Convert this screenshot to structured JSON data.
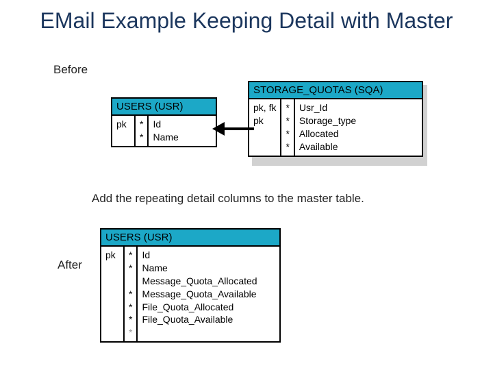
{
  "title": "EMail Example Keeping Detail with Master",
  "labels": {
    "before": "Before",
    "after": "After",
    "middle": "Add the repeating detail columns to the master table."
  },
  "users_before": {
    "header": "USERS (USR)",
    "keys": "pk",
    "stars": "*\n*",
    "cols": "Id\nName"
  },
  "sqa": {
    "header": "STORAGE_QUOTAS (SQA)",
    "keys": "pk, fk\npk",
    "stars": "*\n*\n*\n*",
    "cols": "Usr_Id\nStorage_type\nAllocated\nAvailable"
  },
  "users_after": {
    "header": "USERS (USR)",
    "keys": "pk",
    "stars": "*\n*\n\n*\n*\n*",
    "trailing_star": "*",
    "cols": "Id\nName\nMessage_Quota_Allocated\nMessage_Quota_Available\nFile_Quota_Allocated\nFile_Quota_Available"
  }
}
